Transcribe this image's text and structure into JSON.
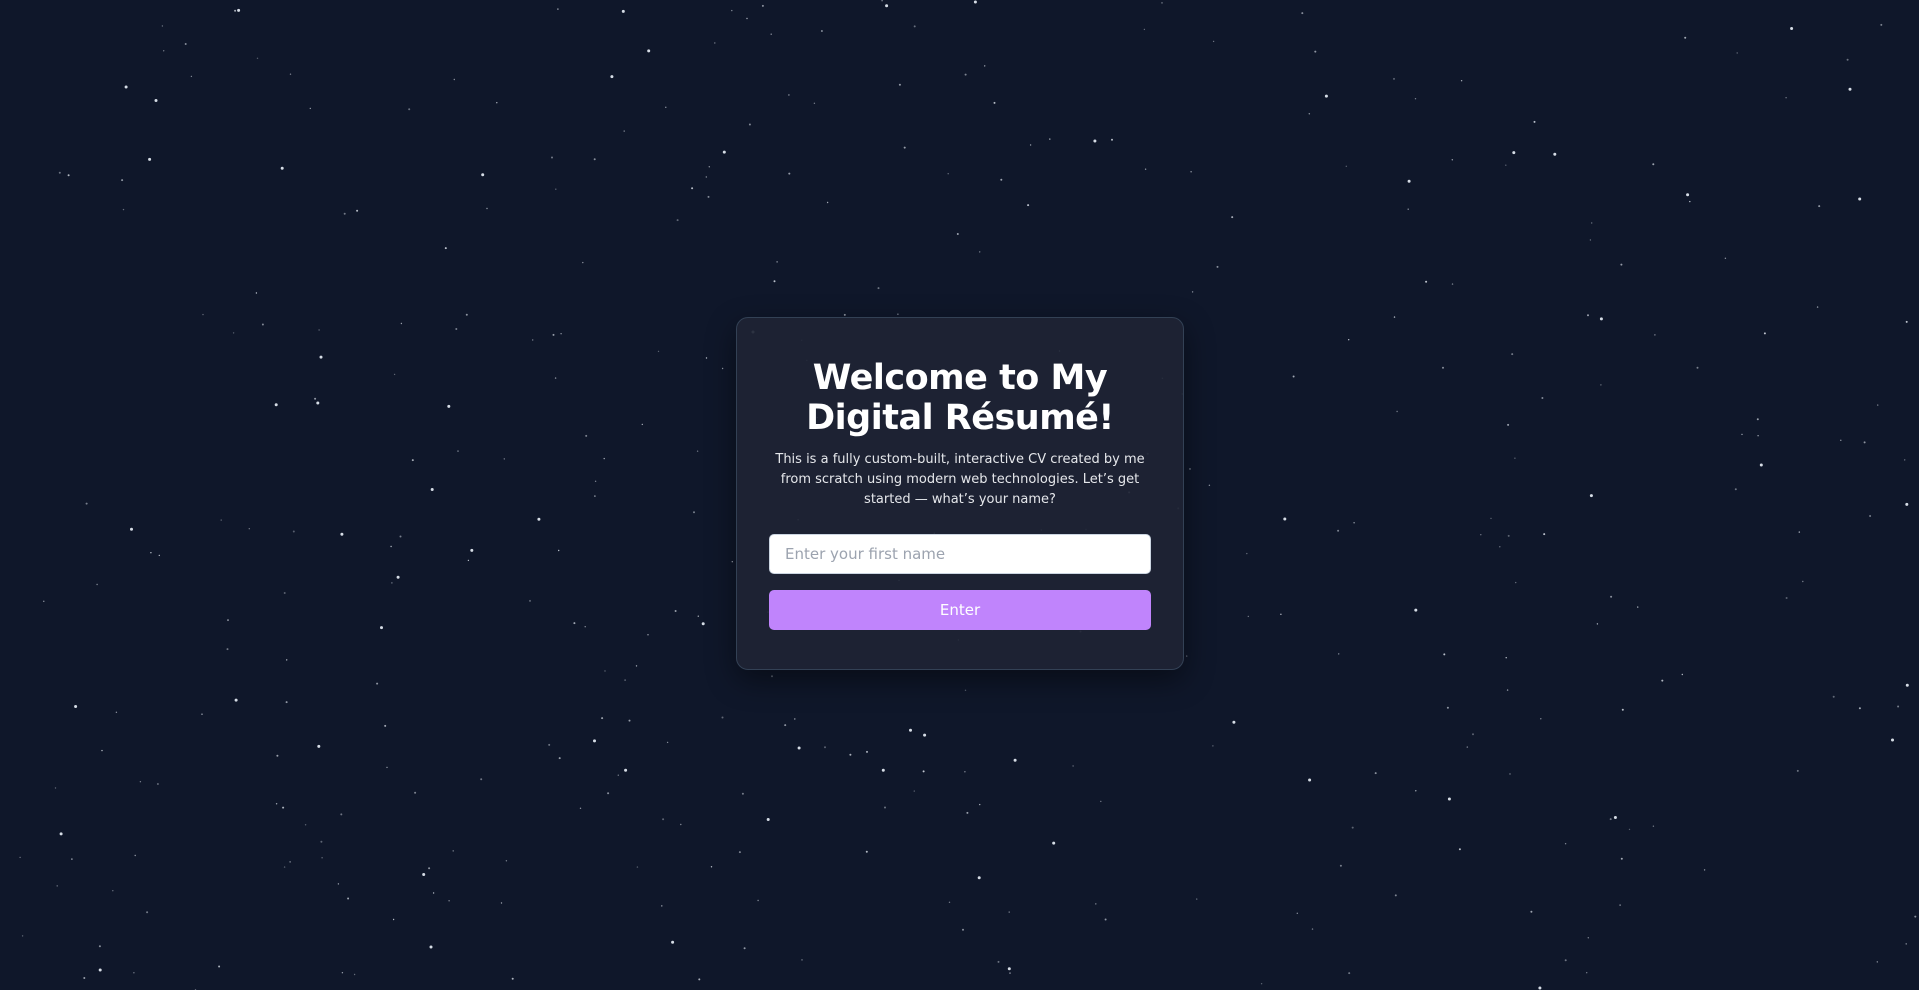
{
  "background_color": "#0f172a",
  "accent_color": "#c084fc",
  "welcome": {
    "title_line1": "Welcome to My",
    "title_line2": "Digital Résumé!",
    "description": "This is a fully custom-built, interactive CV created by me from scratch using modern web technologies. Let’s get started — what’s your name?",
    "name_input": {
      "value": "",
      "placeholder": "Enter your first name"
    },
    "enter_label": "Enter"
  }
}
